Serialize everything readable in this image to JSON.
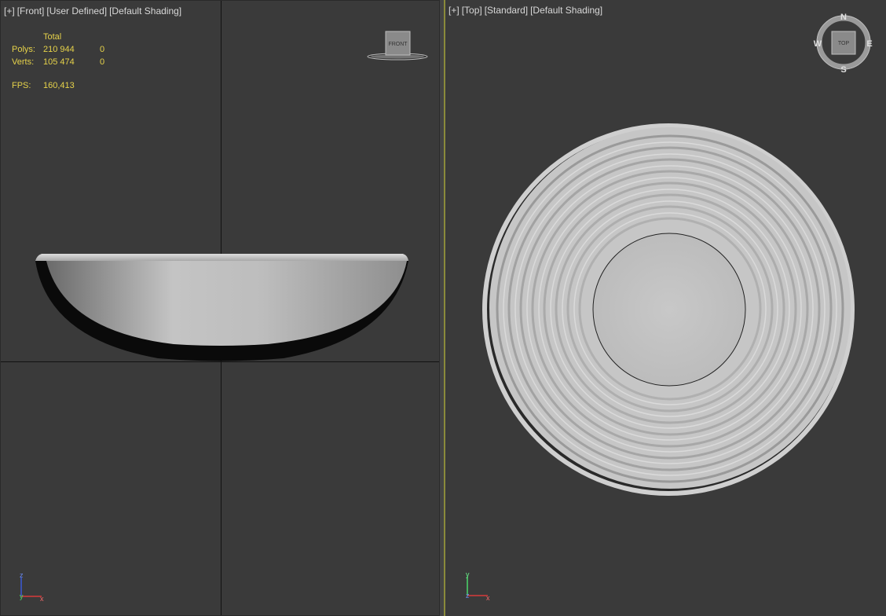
{
  "viewports": {
    "front": {
      "labels": [
        "[+]",
        "[Front]",
        "[User Defined]",
        "[Default Shading]"
      ],
      "viewcube_label": "FRONT",
      "stats": {
        "header": "Total",
        "rows": [
          {
            "label": "Polys:",
            "total": "210 944",
            "selected": "0"
          },
          {
            "label": "Verts:",
            "total": "105 474",
            "selected": "0"
          }
        ],
        "fps_label": "FPS:",
        "fps_value": "160,413"
      },
      "axis": {
        "up": "z",
        "right": "x",
        "origin": "y"
      }
    },
    "top": {
      "labels": [
        "[+]",
        "[Top]",
        "[Standard]",
        "[Default Shading]"
      ],
      "viewcube_label": "TOP",
      "compass": {
        "n": "N",
        "s": "S",
        "e": "E",
        "w": "W"
      },
      "axis": {
        "up": "y",
        "right": "x",
        "origin": "z"
      }
    }
  },
  "colors": {
    "stats_text": "#e6d24a",
    "active_border": "#8a8a3a",
    "viewport_bg": "#3a3a3a"
  }
}
